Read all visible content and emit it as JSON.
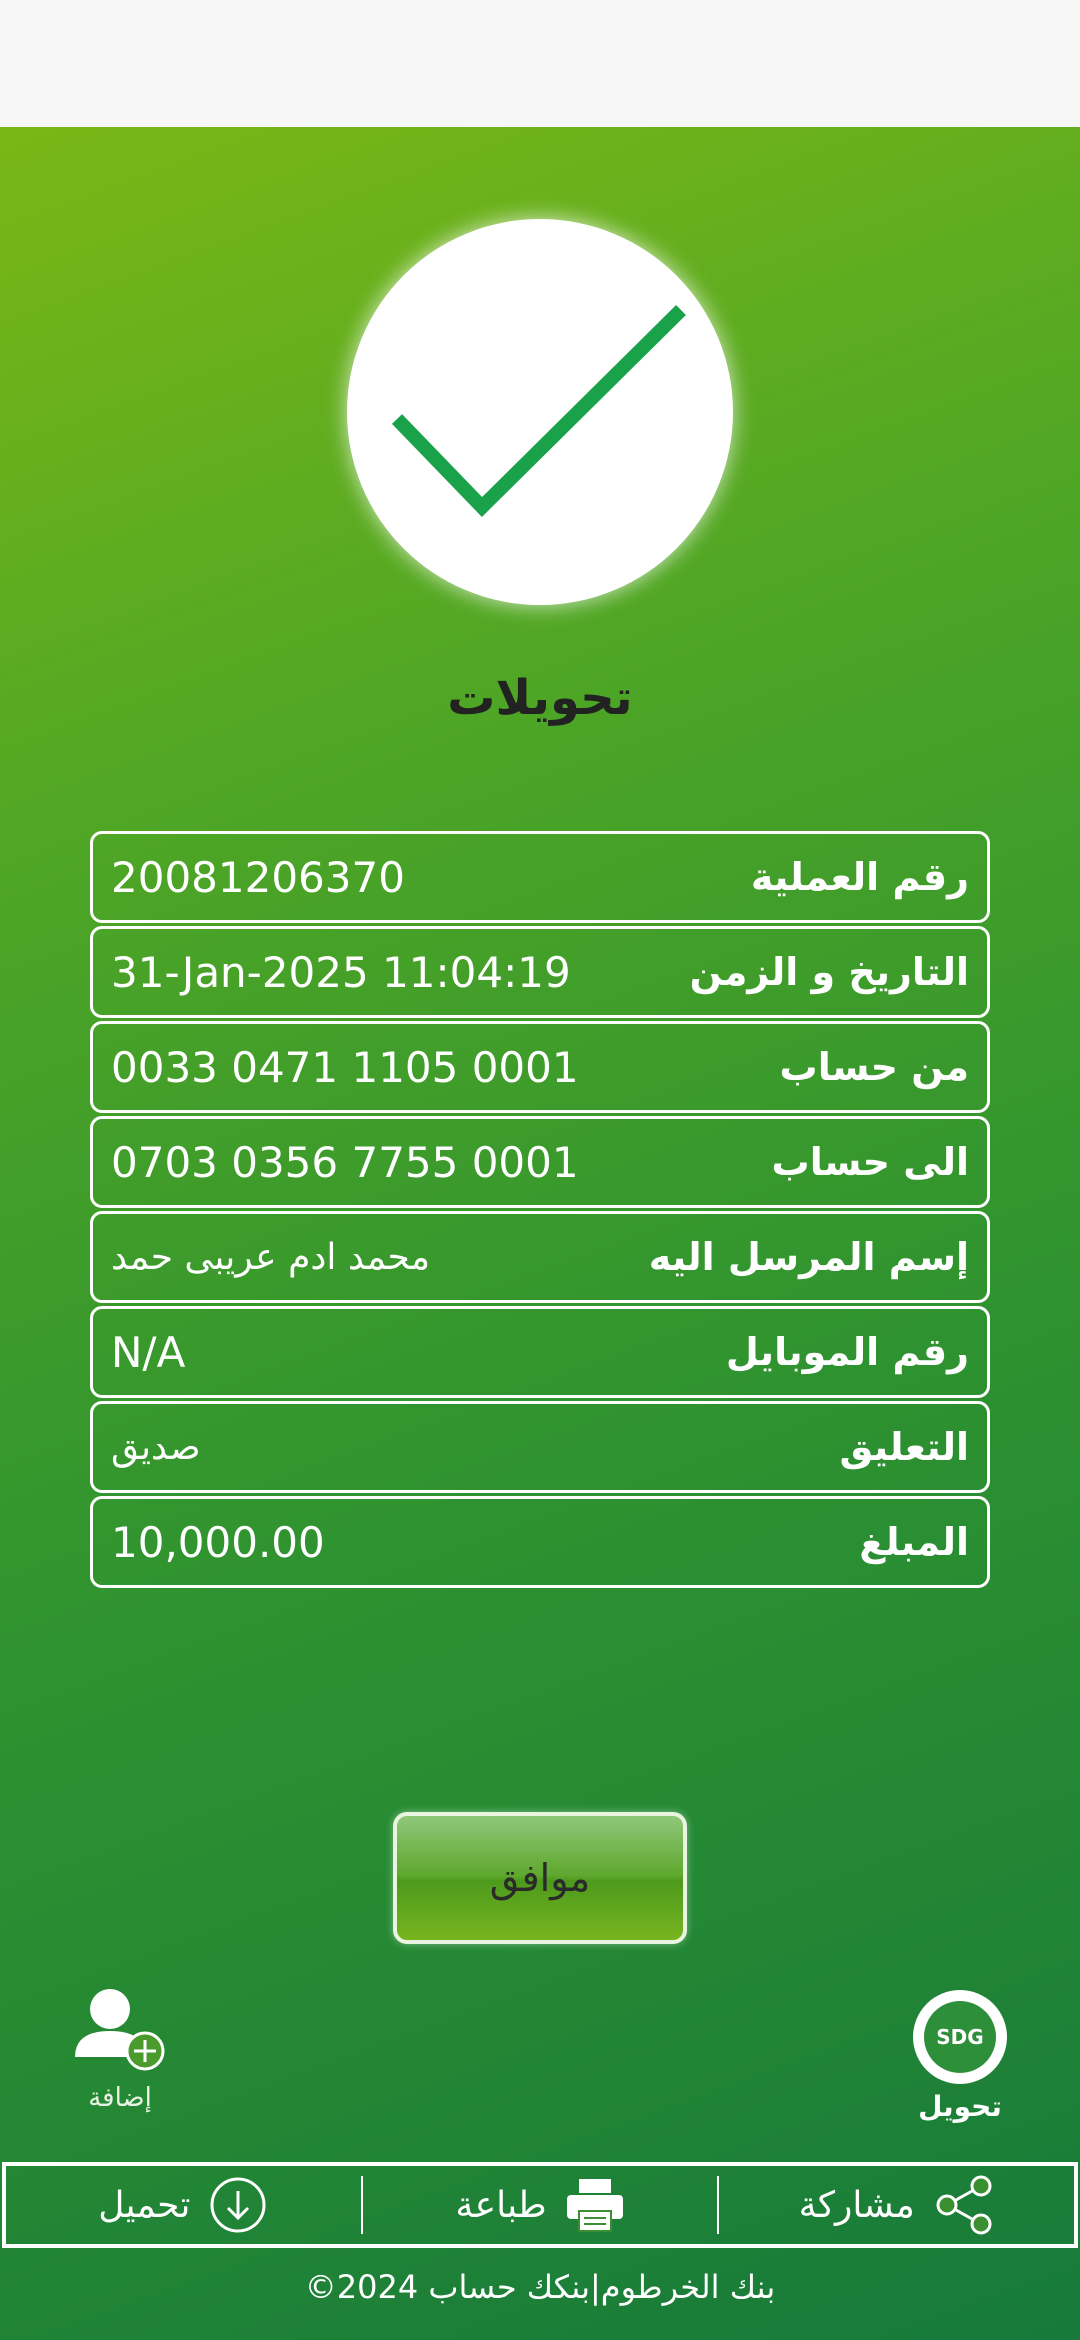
{
  "title": "تحويلات",
  "details": [
    {
      "label": "رقم العملية",
      "value": "20081206370"
    },
    {
      "label": "التاريخ و الزمن",
      "value": "31-Jan-2025 11:04:19"
    },
    {
      "label": "من حساب",
      "value": "0033 0471 1105 0001"
    },
    {
      "label": "الى حساب",
      "value": "0703 0356 7755 0001"
    },
    {
      "label": "إسم المرسل اليه",
      "value": "محمد ادم عريبى حمد"
    },
    {
      "label": "رقم الموبايل",
      "value": "N/A"
    },
    {
      "label": "التعليق",
      "value": "صديق"
    },
    {
      "label": "المبلغ",
      "value": "10,000.00"
    }
  ],
  "ok_button": "موافق",
  "shortcuts": {
    "add_label": "إضافة",
    "transfer_label": "تحويل",
    "transfer_logo_text": "SDG"
  },
  "actions": {
    "download": "تحميل",
    "print": "طباعة",
    "share": "مشاركة"
  },
  "footer": "©2024 بنك الخرطوم|بنكك حساب",
  "colors": {
    "gradient_top": "#7ab716",
    "gradient_bottom": "#177a3a",
    "check": "#1aa24a"
  }
}
